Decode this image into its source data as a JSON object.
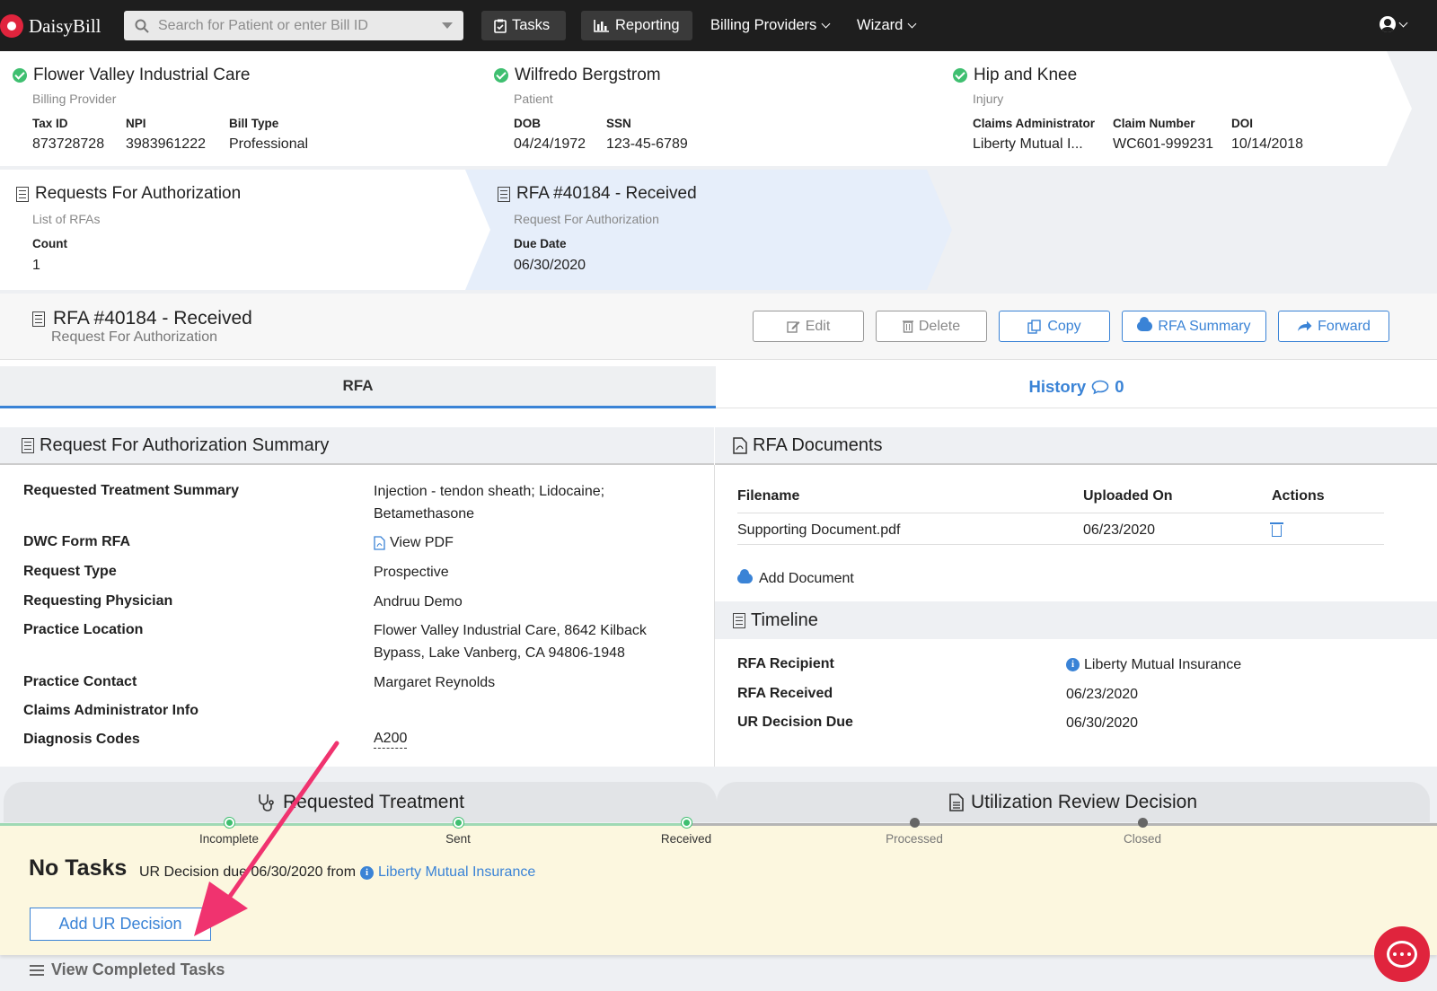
{
  "nav": {
    "logo": "DaisyBill",
    "search_placeholder": "Search for Patient or enter Bill ID",
    "tasks": "Tasks",
    "reporting": "Reporting",
    "billing_providers": "Billing Providers",
    "wizard": "Wizard"
  },
  "crumbs": {
    "provider": {
      "title": "Flower Valley Industrial Care",
      "subtitle": "Billing Provider",
      "tax_id_label": "Tax ID",
      "tax_id": "873728728",
      "npi_label": "NPI",
      "npi": "3983961222",
      "bill_type_label": "Bill Type",
      "bill_type": "Professional"
    },
    "patient": {
      "title": "Wilfredo Bergstrom",
      "subtitle": "Patient",
      "dob_label": "DOB",
      "dob": "04/24/1972",
      "ssn_label": "SSN",
      "ssn": "123-45-6789"
    },
    "injury": {
      "title": "Hip and Knee",
      "subtitle": "Injury",
      "claims_admin_label": "Claims Administrator",
      "claims_admin": "Liberty Mutual I...",
      "claim_number_label": "Claim Number",
      "claim_number": "WC601-999231",
      "doi_label": "DOI",
      "doi": "10/14/2018"
    },
    "rfas": {
      "title": "Requests For Authorization",
      "subtitle": "List of RFAs",
      "count_label": "Count",
      "count": "1"
    },
    "rfa": {
      "title": "RFA #40184 - Received",
      "subtitle": "Request For Authorization",
      "due_label": "Due Date",
      "due": "06/30/2020"
    }
  },
  "header": {
    "title": "RFA #40184 - Received",
    "subtitle": "Request For Authorization",
    "edit": "Edit",
    "delete": "Delete",
    "copy": "Copy",
    "summary": "RFA Summary",
    "forward": "Forward"
  },
  "tabs": {
    "rfa": "RFA",
    "history": "History",
    "history_count": "0"
  },
  "summary": {
    "title": "Request For Authorization Summary",
    "rows": [
      {
        "label": "Requested Treatment Summary",
        "value": "Injection - tendon sheath; Lidocaine; Betamethasone"
      },
      {
        "label": "DWC Form RFA",
        "value": "View PDF"
      },
      {
        "label": "Request Type",
        "value": "Prospective"
      },
      {
        "label": "Requesting Physician",
        "value": "Andruu Demo"
      },
      {
        "label": "Practice Location",
        "value": "Flower Valley Industrial Care, 8642 Kilback Bypass, Lake Vanberg, CA 94806-1948"
      },
      {
        "label": "Practice Contact",
        "value": "Margaret Reynolds"
      },
      {
        "label": "Claims Administrator Info",
        "value": ""
      },
      {
        "label": "Diagnosis Codes",
        "value": "A200"
      }
    ]
  },
  "documents": {
    "title": "RFA Documents",
    "col_filename": "Filename",
    "col_uploaded": "Uploaded On",
    "col_actions": "Actions",
    "rows": [
      {
        "filename": "Supporting Document.pdf",
        "uploaded": "06/23/2020"
      }
    ],
    "add_document": "Add Document"
  },
  "timeline": {
    "title": "Timeline",
    "rows": [
      {
        "label": "RFA Recipient",
        "value": "Liberty Mutual Insurance"
      },
      {
        "label": "RFA Received",
        "value": "06/23/2020"
      },
      {
        "label": "UR Decision Due",
        "value": "06/30/2020"
      }
    ]
  },
  "progress": {
    "requested_treatment": "Requested Treatment",
    "ur_decision": "Utilization Review Decision",
    "steps": [
      "Incomplete",
      "Sent",
      "Received",
      "Processed",
      "Closed"
    ],
    "completed_steps": 3
  },
  "tasks": {
    "heading": "No Tasks",
    "line_prefix": "UR Decision due 06/30/2020 from",
    "line_link": "Liberty Mutual Insurance",
    "add_button": "Add UR Decision",
    "view_completed": "View Completed Tasks"
  },
  "colors": {
    "accent": "#3a83d6",
    "success": "#3fbf70",
    "brand": "#e0243d",
    "annotation_arrow": "#f0336f"
  }
}
